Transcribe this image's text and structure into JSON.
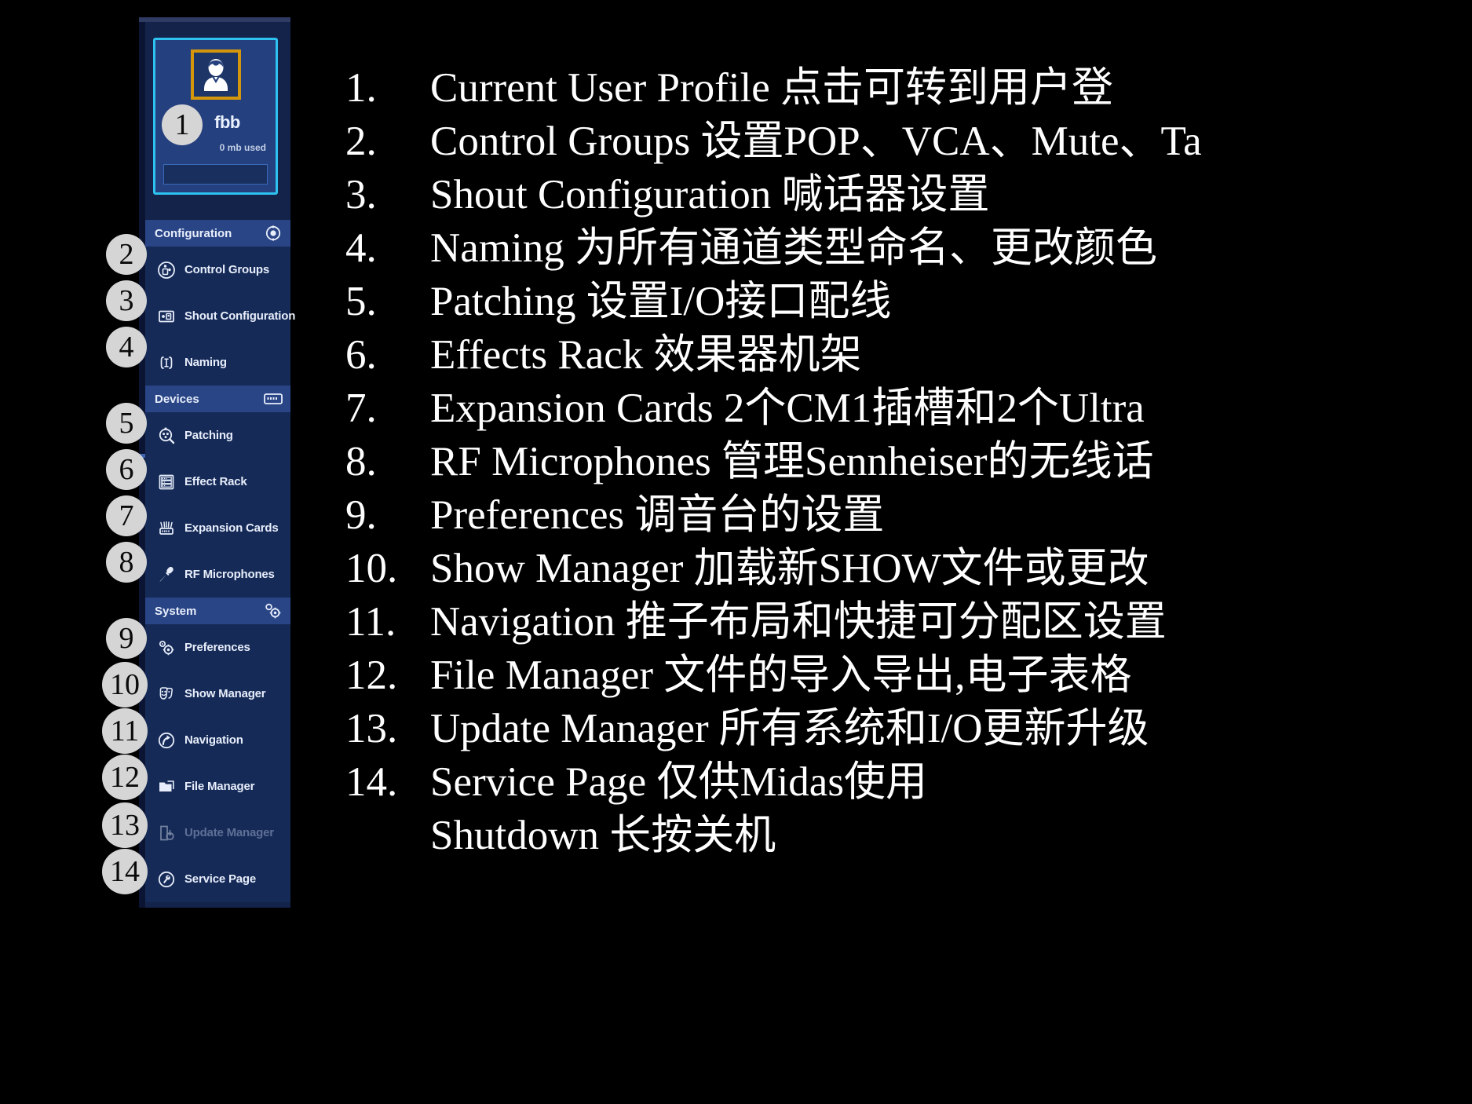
{
  "sidebar": {
    "user_card": {
      "avatar_icon": "user-avatar-icon",
      "name": "fbb",
      "usage": "0 mb used"
    },
    "sections": [
      {
        "label": "Configuration",
        "icon": "target-gear-icon",
        "items": [
          {
            "label": "Control Groups",
            "icon": "control-groups-icon",
            "badge": "2",
            "disabled": false
          },
          {
            "label": "Shout Configuration",
            "icon": "shout-config-icon",
            "badge": "3",
            "disabled": false
          },
          {
            "label": "Naming",
            "icon": "naming-cursor-icon",
            "badge": "4",
            "disabled": false
          }
        ]
      },
      {
        "label": "Devices",
        "icon": "device-card-icon",
        "items": [
          {
            "label": "Patching",
            "icon": "patching-icon",
            "badge": "5",
            "disabled": false
          },
          {
            "label": "Effect Rack",
            "icon": "effect-rack-icon",
            "badge": "6",
            "disabled": false
          },
          {
            "label": "Expansion Cards",
            "icon": "expansion-cards-icon",
            "badge": "7",
            "disabled": false
          },
          {
            "label": "RF Microphones",
            "icon": "microphone-icon",
            "badge": "8",
            "disabled": false
          }
        ]
      },
      {
        "label": "System",
        "icon": "system-gears-icon",
        "items": [
          {
            "label": "Preferences",
            "icon": "gears-icon",
            "badge": "9",
            "disabled": false
          },
          {
            "label": "Show Manager",
            "icon": "theatre-masks-icon",
            "badge": "10",
            "disabled": false
          },
          {
            "label": "Navigation",
            "icon": "navigation-arrow-icon",
            "badge": "11",
            "disabled": false
          },
          {
            "label": "File Manager",
            "icon": "folder-icon",
            "badge": "12",
            "disabled": false
          },
          {
            "label": "Update Manager",
            "icon": "update-download-icon",
            "badge": "13",
            "disabled": true
          },
          {
            "label": "Service Page",
            "icon": "wrench-icon",
            "badge": "14",
            "disabled": false
          }
        ]
      }
    ]
  },
  "annotations": {
    "lines": [
      {
        "num": "1.",
        "text": "Current User Profile 点击可转到用户登"
      },
      {
        "num": "2.",
        "text": "Control Groups 设置POP、VCA、Mute、Ta"
      },
      {
        "num": "3.",
        "text": "Shout Configuration 喊话器设置"
      },
      {
        "num": "4.",
        "text": "Naming 为所有通道类型命名、更改颜色"
      },
      {
        "num": "5.",
        "text": "Patching 设置I/O接口配线"
      },
      {
        "num": "6.",
        "text": "Effects Rack 效果器机架"
      },
      {
        "num": "7.",
        "text": "Expansion Cards 2个CM1插槽和2个Ultra"
      },
      {
        "num": "8.",
        "text": "RF Microphones 管理Sennheiser的无线话"
      },
      {
        "num": "9.",
        "text": "Preferences 调音台的设置"
      },
      {
        "num": "10.",
        "text": "Show Manager 加载新SHOW文件或更改"
      },
      {
        "num": "11.",
        "text": "Navigation 推子布局和快捷可分配区设置"
      },
      {
        "num": "12.",
        "text": "File Manager 文件的导入导出,电子表格"
      },
      {
        "num": "13.",
        "text": "Update Manager 所有系统和I/O更新升级"
      },
      {
        "num": "14.",
        "text": "Service Page 仅供Midas使用"
      },
      {
        "num": "",
        "text": "Shutdown 长按关机"
      }
    ]
  },
  "colors": {
    "background": "#000000",
    "panel": "#132349",
    "section_header": "#2a4586",
    "menu_row": "#152a57",
    "accent_cyan": "#2ec2f0",
    "accent_gold": "#d4960b",
    "badge_fill": "#d5d5d5",
    "text_white": "#ffffff"
  }
}
